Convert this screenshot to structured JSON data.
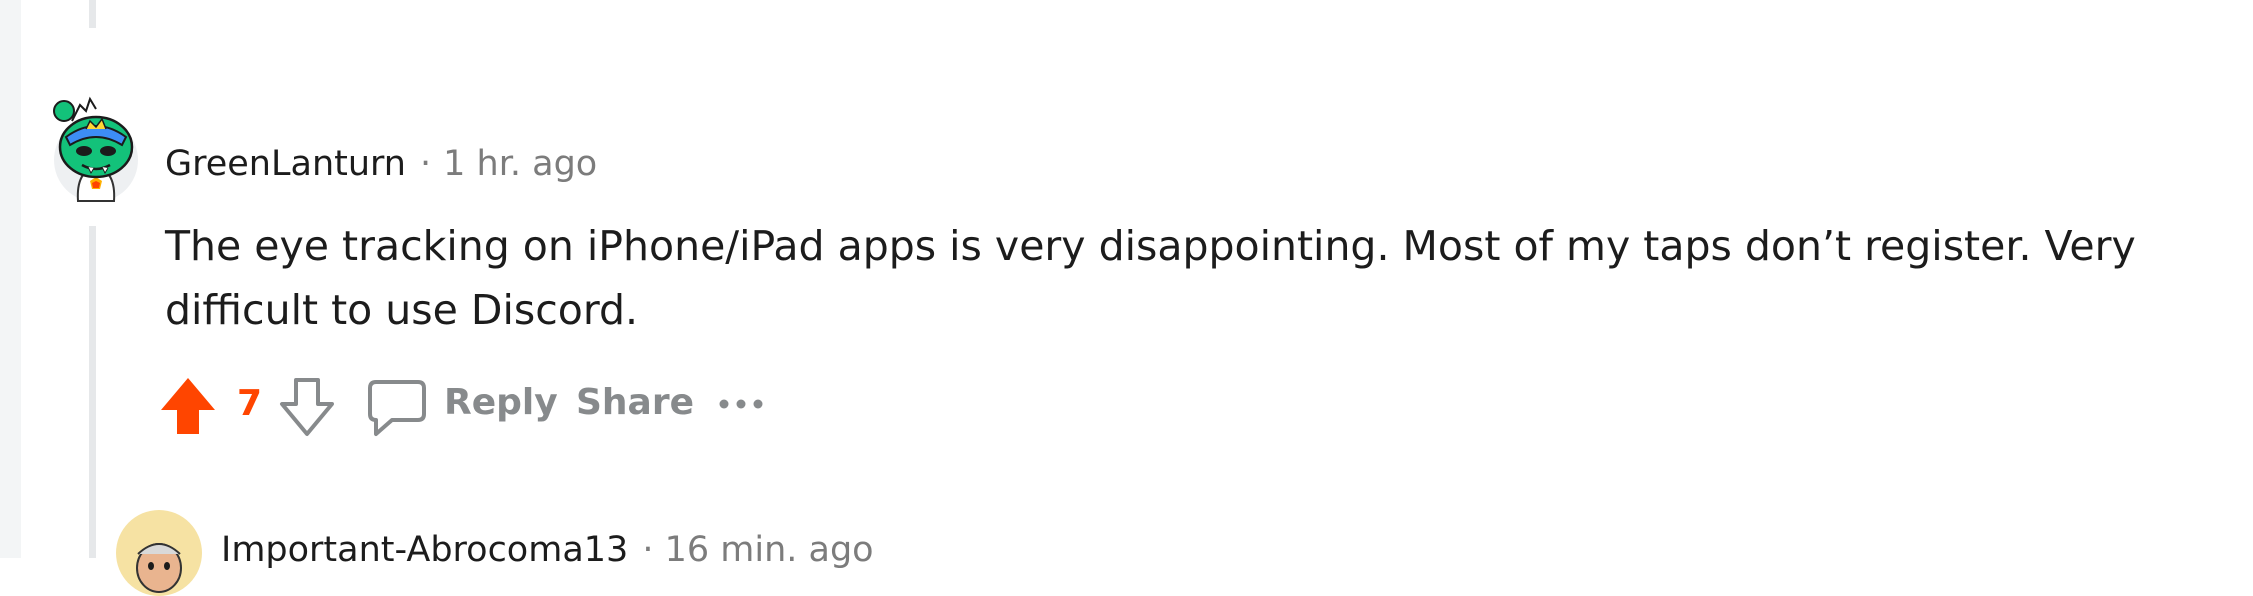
{
  "comment": {
    "author": "GreenLanturn",
    "separator": "·",
    "time": "1 hr. ago",
    "body": "The eye tracking on iPhone/iPad apps is very disappointing. Most of my taps don’t register. Very difficult to use Discord.",
    "score": "7",
    "vote_state": "upvoted",
    "actions": {
      "reply": "Reply",
      "share": "Share"
    },
    "icons": {
      "upvote": "upvote-arrow-icon",
      "downvote": "downvote-arrow-icon",
      "comment": "comment-bubble-icon",
      "more": "more-options-icon"
    }
  },
  "next_comment": {
    "author": "Important-Abrocoma13",
    "separator": "·",
    "time": "16 min. ago"
  },
  "colors": {
    "upvote": "#ff4500",
    "action_text": "#878a8c",
    "thread_line": "#e6e8ea",
    "body_text": "#1c1c1c",
    "meta_text": "#7c7c7c"
  }
}
